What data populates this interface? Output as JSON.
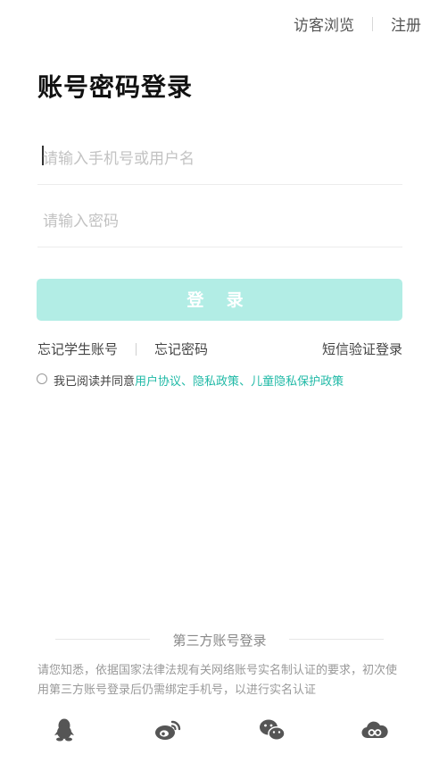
{
  "topbar": {
    "guest_label": "访客浏览",
    "register_label": "注册"
  },
  "header": {
    "title": "账号密码登录"
  },
  "form": {
    "username_placeholder": "请输入手机号或用户名",
    "password_placeholder": "请输入密码",
    "login_label": "登 录"
  },
  "links": {
    "forgot_student_account": "忘记学生账号",
    "forgot_password": "忘记密码",
    "sms_login": "短信验证登录"
  },
  "agreement": {
    "prefix": "我已阅读并同意",
    "user_agreement": "用户协议",
    "sep1": "、",
    "privacy_policy": "隐私政策",
    "sep2": "、",
    "child_privacy": "儿童隐私保护政策"
  },
  "third_party": {
    "title": "第三方账号登录",
    "notice": "请您知悉，依据国家法律法规有关网络账号实名制认证的要求，初次使用第三方账号登录后仍需绑定手机号，以进行实名认证",
    "icons": [
      "qq-icon",
      "weibo-icon",
      "wechat-icon",
      "cloud-icon"
    ]
  },
  "colors": {
    "accent": "#1fb9a6",
    "login_button_bg": "#b2ede5",
    "icon_color": "#555555"
  }
}
